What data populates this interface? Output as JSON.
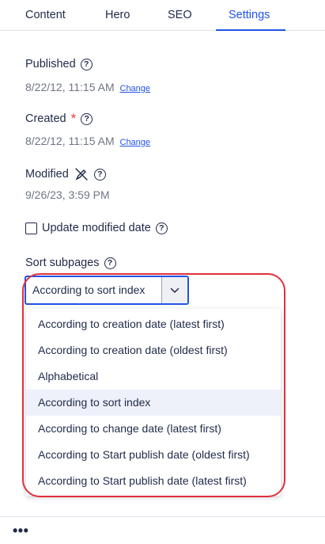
{
  "tabs": [
    {
      "label": "Content"
    },
    {
      "label": "Hero"
    },
    {
      "label": "SEO"
    },
    {
      "label": "Settings"
    }
  ],
  "active_tab": "Settings",
  "published": {
    "label": "Published",
    "value": "8/22/12, 11:15 AM",
    "change": "Change"
  },
  "created": {
    "label": "Created",
    "required": "*",
    "value": "8/22/12, 11:15 AM",
    "change": "Change"
  },
  "modified": {
    "label": "Modified",
    "value": "9/26/23, 3:59 PM"
  },
  "update_modified": {
    "label": "Update modified date",
    "checked": false
  },
  "sort": {
    "label": "Sort subpages",
    "selected": "According to sort index",
    "options": [
      "According to creation date (latest first)",
      "According to creation date (oldest first)",
      "Alphabetical",
      "According to sort index",
      "According to change date (latest first)",
      "According to Start publish date (oldest first)",
      "According to Start publish date (latest first)"
    ]
  },
  "footer": {
    "more": "•••"
  },
  "colors": {
    "accent": "#2152e8",
    "required": "#e43a3a",
    "highlight": "#e0303a",
    "text": "#1f2a48",
    "muted": "#6f7585"
  },
  "icons": {
    "help": "help-circle-icon",
    "modified_indicator": "pen-off-icon",
    "dropdown": "chevron-down-icon",
    "more": "more-horizontal-icon"
  }
}
